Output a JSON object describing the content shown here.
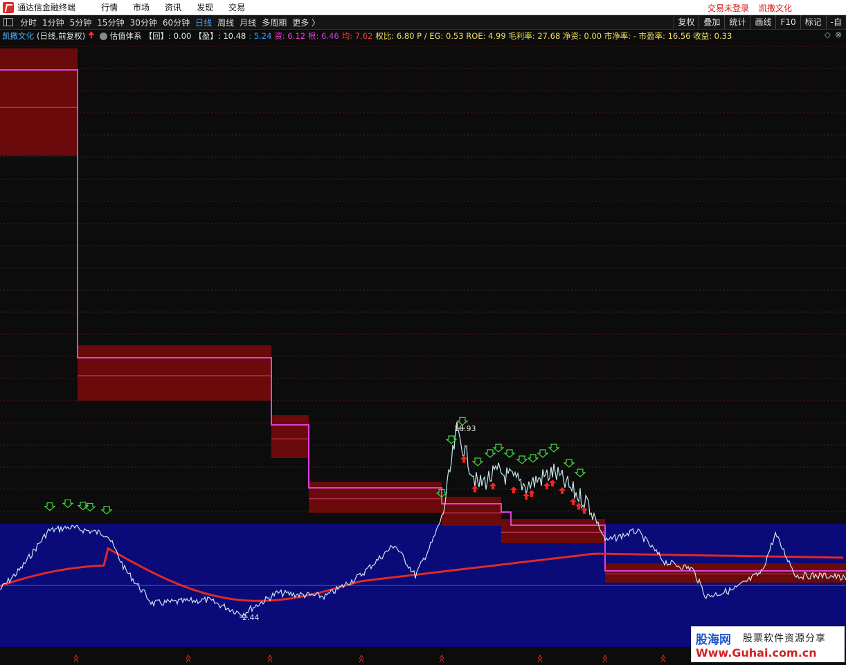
{
  "app": {
    "title": "通达信金融终端",
    "menu": [
      "行情",
      "市场",
      "资讯",
      "发现",
      "交易"
    ],
    "status_login": "交易未登录",
    "current_stock": "凯撒文化"
  },
  "toolbar": {
    "periods": [
      "分时",
      "1分钟",
      "5分钟",
      "15分钟",
      "30分钟",
      "60分钟",
      "日线",
      "周线",
      "月线",
      "多周期",
      "更多 〉"
    ],
    "active_period": "日线",
    "right_buttons": [
      "复权",
      "叠加",
      "统计",
      "画线",
      "F10",
      "标记",
      "-自"
    ]
  },
  "info": {
    "stock_name": "凯撒文化",
    "period_label": "(日线,前复权)",
    "formula_name": "估值体系",
    "hui": "【回】: 0.00",
    "ying": "【盈】: 10.48",
    "v1": ": 5.24",
    "zi": "资: 6.12",
    "gen": "根: 6.46",
    "jun": "均: 7.62",
    "stats": "权比: 6.80  P / EG: 0.53  ROE: 4.99  毛利率: 27.68  净资: 0.00  市净率: -  市盈率: 16.56  收益: 0.33",
    "right_icons": [
      "◇",
      "⊗"
    ]
  },
  "chart_labels": {
    "high": "18.93",
    "low": "2.44"
  },
  "colors": {
    "background": "#0c0c0c",
    "blue_band": "#0a0a78",
    "valuation_box": "#6a0a0a",
    "valuation_line": "#e040e0",
    "ma_line": "#e02828",
    "price_line": "#c8e8f0",
    "buy_arrow": "#40e040",
    "sell_arrow": "#ff2020"
  },
  "watermark": {
    "brand": "股海网",
    "slogan": "股票软件资源分享",
    "url": "Www.Guhai.com.cn"
  }
}
